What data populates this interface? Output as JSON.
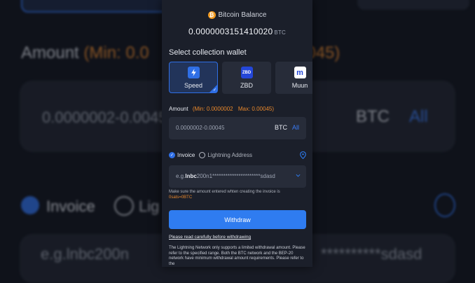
{
  "background": {
    "amount_label": "Amount",
    "amount_range_visible": "(Min: 0.0",
    "amount_range_tail": "0045)",
    "amount_placeholder": "0.0000002-0.0045",
    "currency": "BTC",
    "all_label": "All",
    "invoice_label": "Invoice",
    "lightning_partial": "Lig",
    "invoice_placeholder_partial": "e.g.lnbc200n",
    "invoice_tail_partial": "**********sdasd"
  },
  "header": {
    "balance_label": "Bitcoin Balance",
    "balance_value": "0.0000003151410020",
    "balance_unit": "BTC"
  },
  "wallet_section": {
    "title": "Select collection wallet",
    "wallets": [
      {
        "label": "Speed",
        "icon": "speed-lightning-icon",
        "selected": true,
        "color": "#2f6fe6"
      },
      {
        "label": "ZBD",
        "icon": "zbd-icon",
        "selected": false,
        "color": "#2447d8"
      },
      {
        "label": "Muun",
        "icon": "muun-icon",
        "selected": false,
        "color": "#ffffff"
      }
    ]
  },
  "amount": {
    "label": "Amount",
    "min_text": "(Min: 0.0000002",
    "max_text": "Max: 0.00045)",
    "placeholder": "0.0000002-0.00045",
    "currency": "BTC",
    "all_label": "All"
  },
  "method": {
    "invoice_label": "Invoice",
    "lightning_label": "Lightning Address",
    "selected": "Invoice"
  },
  "invoice_input": {
    "placeholder_prefix": "e.g.",
    "placeholder_bold": "lnbc",
    "placeholder_rest": "200n1**********************sdasd"
  },
  "note": {
    "line1": "Make sure the amount entered whten creating the invoice is",
    "line2": "0sats=0BTC"
  },
  "withdraw_button": "Withdraw",
  "read_link": "Please read carefully before withdrawing",
  "info_text": "The Lightning Network only supports a limited withdrawal amount. Please refer to the specified range. Both the BTC network and the BEP-20 network have minimum withdrawal amount requirements. Please refer to the",
  "colors": {
    "accent": "#2f7cf0",
    "warning": "#e8872b",
    "bitcoin": "#f29a20"
  }
}
